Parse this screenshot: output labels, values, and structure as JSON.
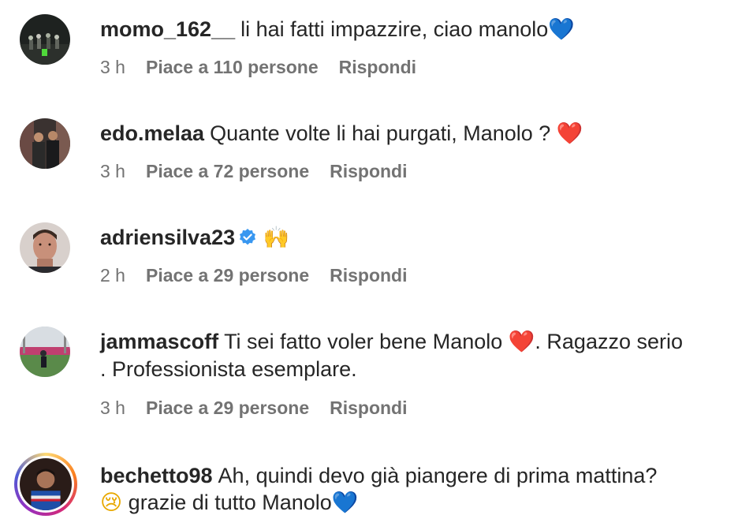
{
  "comments": [
    {
      "username": "momo_162__",
      "text": "li hai fatti impazzire, ciao manolo",
      "emoji": "💙",
      "time": "3 h",
      "likes": "Piace a 110 persone",
      "reply": "Rispondi"
    },
    {
      "username": "edo.melaa",
      "text": "Quante volte li hai purgati, Manolo ?",
      "emoji": "❤️",
      "time": "3 h",
      "likes": "Piace a 72 persone",
      "reply": "Rispondi"
    },
    {
      "username": "adriensilva23",
      "text": "",
      "emoji": "🙌",
      "time": "2 h",
      "likes": "Piace a 29 persone",
      "reply": "Rispondi"
    },
    {
      "username": "jammascoff",
      "text_part1": "Ti sei fatto voler bene Manolo",
      "emoji": "❤️",
      "text_part2": ". Ragazzo serio",
      "text_line2": ". Professionista esemplare.",
      "time": "3 h",
      "likes": "Piace a 29 persone",
      "reply": "Rispondi"
    },
    {
      "username": "bechetto98",
      "text_line1": "Ah, quindi devo già piangere di prima mattina?",
      "emoji_cry": "😢",
      "text_line2": "grazie di tutto Manolo",
      "emoji": "💙"
    }
  ]
}
